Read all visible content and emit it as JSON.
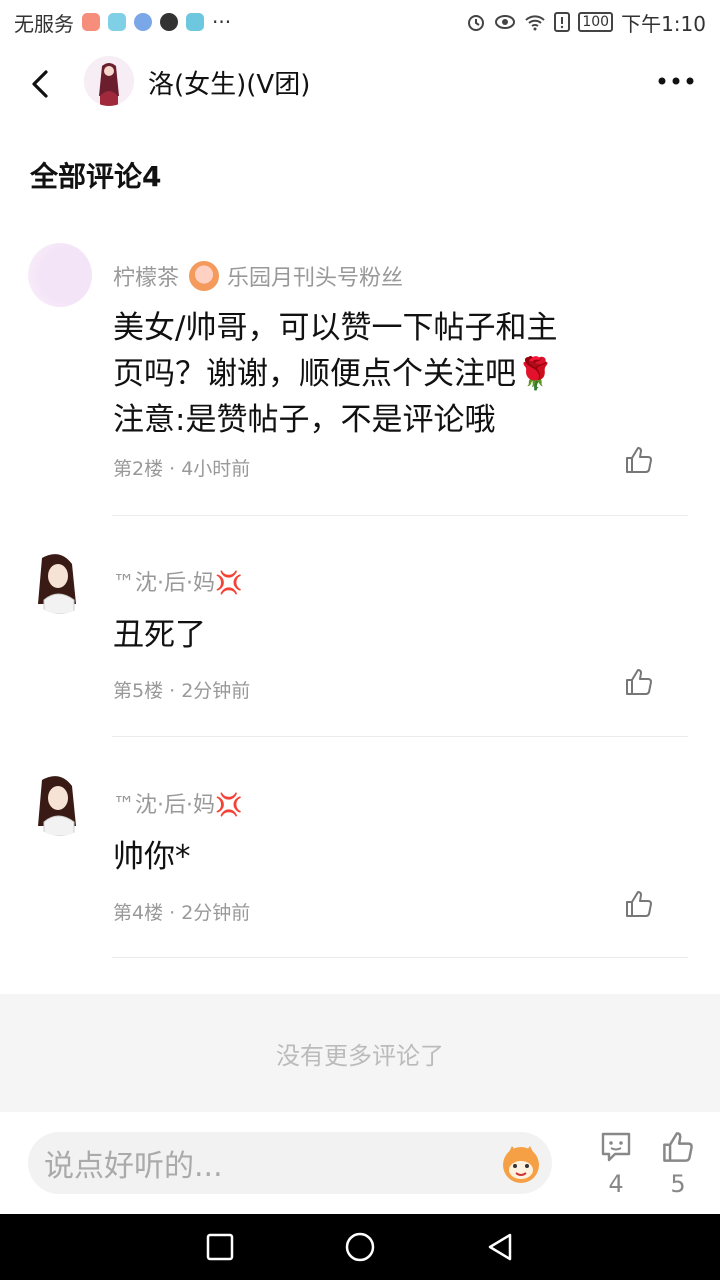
{
  "status": {
    "left_text": "无服务",
    "more": "···",
    "battery": "100",
    "time": "下午1:10"
  },
  "header": {
    "title": "洛(女生)(V团)"
  },
  "comments_header": "全部评论4",
  "comments": [
    {
      "name": "柠檬茶",
      "badge": "乐园月刊头号粉丝",
      "text_lines": [
        "美女/帅哥，可以赞一下帖子和主",
        "页吗？谢谢，顺便点个关注吧🌹",
        "注意:是赞帖子，不是评论哦"
      ],
      "meta": "第2楼 · 4小时前"
    },
    {
      "name": "™沈·后·妈💢",
      "text_lines": [
        "丑死了"
      ],
      "meta": "第5楼 · 2分钟前"
    },
    {
      "name": "™沈·后·妈💢",
      "text_lines": [
        "帅你*"
      ],
      "meta": "第4楼 · 2分钟前"
    }
  ],
  "no_more": "没有更多评论了",
  "input": {
    "placeholder": "说点好听的..."
  },
  "actions": {
    "comment_count": "4",
    "like_count": "5"
  },
  "icons": [
    "back-icon",
    "more-icon",
    "like-icon",
    "comment-icon",
    "emoji-icon",
    "nav-square-icon",
    "nav-home-icon",
    "nav-back-icon"
  ],
  "colors": {
    "muted_text": "#999999",
    "footer_bg": "#f5f5f5",
    "badge": "#f39a5c"
  }
}
